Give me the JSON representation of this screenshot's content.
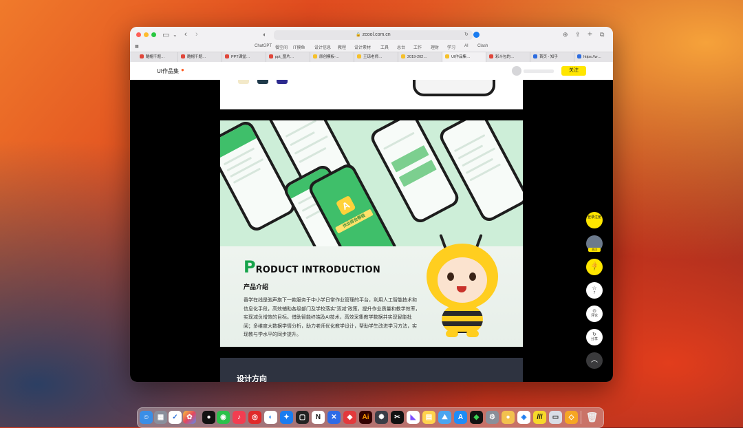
{
  "browser": {
    "url": "zcool.com.cn",
    "bookmarks": [
      "ChatGPT",
      "餐空间",
      "IT摸鱼",
      "设计信息",
      "教程",
      "设计素材",
      "工具",
      "总台",
      "工作",
      "理财",
      "学习",
      "AI",
      "Clash"
    ],
    "tabs": [
      {
        "label": "酷帽千题…",
        "color": "#e0463a"
      },
      {
        "label": "酷帽千题…",
        "color": "#e0463a"
      },
      {
        "label": "PPT课堂…",
        "color": "#e0463a"
      },
      {
        "label": "ppt_图片…",
        "color": "#e0463a"
      },
      {
        "label": "原创模板-…",
        "color": "#f5c02a"
      },
      {
        "label": "王琼老师…",
        "color": "#f5c02a"
      },
      {
        "label": "2019-202…",
        "color": "#f5c02a"
      },
      {
        "label": "UI作品集…",
        "color": "#f5c02a"
      },
      {
        "label": "彩斗包的…",
        "color": "#e0463a"
      },
      {
        "label": "首页 - 知乎",
        "color": "#2d6cdf"
      },
      {
        "label": "https://w…",
        "color": "#2d6cdf"
      }
    ]
  },
  "site": {
    "title": "UI作品集",
    "follow_label": "关注"
  },
  "article": {
    "product_heading_big": "P",
    "product_heading_rest": "RODUCT INTRODUCTION",
    "product_subheading": "产品介绍",
    "product_body": "番学在线是驰声旗下一款服务于中小学日常作业管理的平台，利用人工智能技术和信息化手段，高效辅助各级部门及学校落实“双减”政策，提升作业质量和教学效率，实现减负增效的目标。借助智能终端及AI技术，高效采集教学数据并实现智能批阅；多维度大数据学情分析，助力老师优化教学设计，帮助学生改进学习方法，实现教与学水平的同步提升。",
    "phone_banner": "作业综合等级",
    "trophy_letter": "A",
    "section2_title": "设计方向"
  },
  "sidebar": {
    "login_label": "登录注册",
    "follow_label": "关注",
    "like_count": "7",
    "star_count": "7",
    "comment_label": "评论",
    "share_label": "分享"
  },
  "colors": {
    "accent_yellow": "#ffe600",
    "brand_green": "#3fbf6a"
  }
}
